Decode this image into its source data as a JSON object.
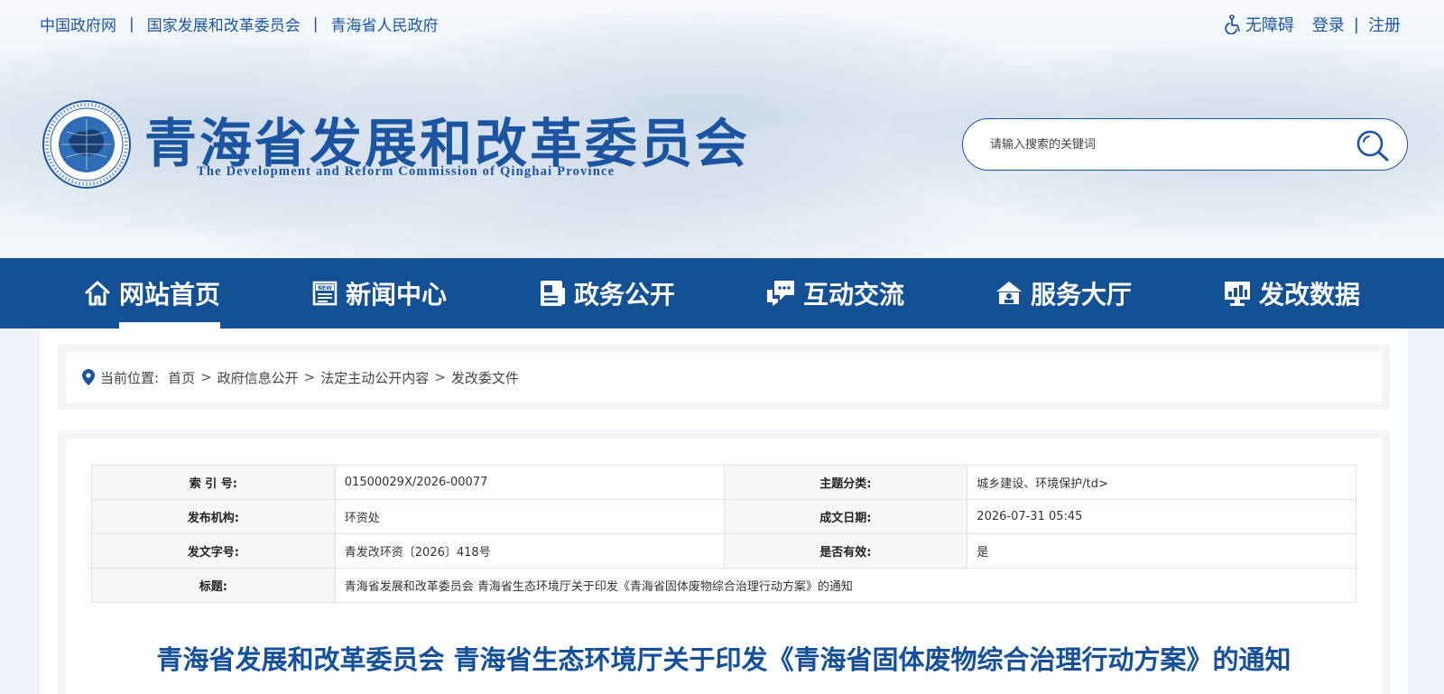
{
  "top_links": [
    "中国政府网",
    "国家发展和改革委员会",
    "青海省人民政府"
  ],
  "top_separators": [
    "|",
    "|"
  ],
  "user_links": {
    "accessibility": "无障碍",
    "login": "登录",
    "separator": "|",
    "register": "注册"
  },
  "site": {
    "title": "青海省发展和改革委员会",
    "subtitle": "The Development and Reform Commission of Qinghai Province"
  },
  "search": {
    "placeholder": "请输入搜索的关键词",
    "icon": "search-icon"
  },
  "nav": {
    "items": [
      {
        "label": "网站首页",
        "icon": "home-icon",
        "active": true
      },
      {
        "label": "新闻中心",
        "icon": "news-icon",
        "active": false
      },
      {
        "label": "政务公开",
        "icon": "document-icon",
        "active": false
      },
      {
        "label": "互动交流",
        "icon": "chat-icon",
        "active": false
      },
      {
        "label": "服务大厅",
        "icon": "service-hall-icon",
        "active": false
      },
      {
        "label": "发改数据",
        "icon": "data-chart-icon",
        "active": false
      }
    ]
  },
  "breadcrumb": {
    "label": "当前位置:",
    "items": [
      "首页",
      "政府信息公开",
      "法定主动公开内容",
      "发改委文件"
    ],
    "separator": ">"
  },
  "meta": {
    "index_no_label": "索 引 号:",
    "index_no": "01500029X/2026-00077",
    "topic_label": "主题分类:",
    "topic": "城乡建设、环境保护/td>",
    "publisher_label": "发布机构:",
    "publisher": "环资处",
    "date_label": "成文日期:",
    "date": "2026-07-31 05:45",
    "doc_no_label": "发文字号:",
    "doc_no": "青发改环资〔2026〕418号",
    "valid_label": "是否有效:",
    "valid": "是",
    "title_label": "标题:",
    "title": "青海省发展和改革委员会 青海省生态环境厅关于印发《青海省固体废物综合治理行动方案》的通知"
  },
  "document": {
    "title": "青海省发展和改革委员会 青海省生态环境厅关于印发《青海省固体废物综合治理行动方案》的通知"
  },
  "colors": {
    "brand_blue": "#135094",
    "link_blue": "#1a56a4",
    "title_blue": "#15509b"
  }
}
